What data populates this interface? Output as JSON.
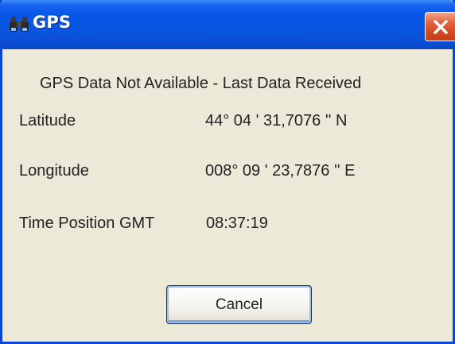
{
  "window": {
    "title": "GPS",
    "icon": "binoculars-icon",
    "close_icon": "close-icon"
  },
  "dialog": {
    "status_message": "GPS Data Not Available - Last Data Received",
    "fields": [
      {
        "label": "Latitude",
        "value": "44° 04 ' 31,7076 '' N"
      },
      {
        "label": "Longitude",
        "value": "008° 09 ' 23,7876 '' E"
      },
      {
        "label": "Time Position GMT",
        "value": "08:37:19"
      }
    ],
    "cancel_label": "Cancel"
  },
  "colors": {
    "titlebar_blue": "#0a55e0",
    "frame_blue": "#0a45d8",
    "dialog_background": "#ece9d8",
    "close_red": "#d24a22"
  }
}
